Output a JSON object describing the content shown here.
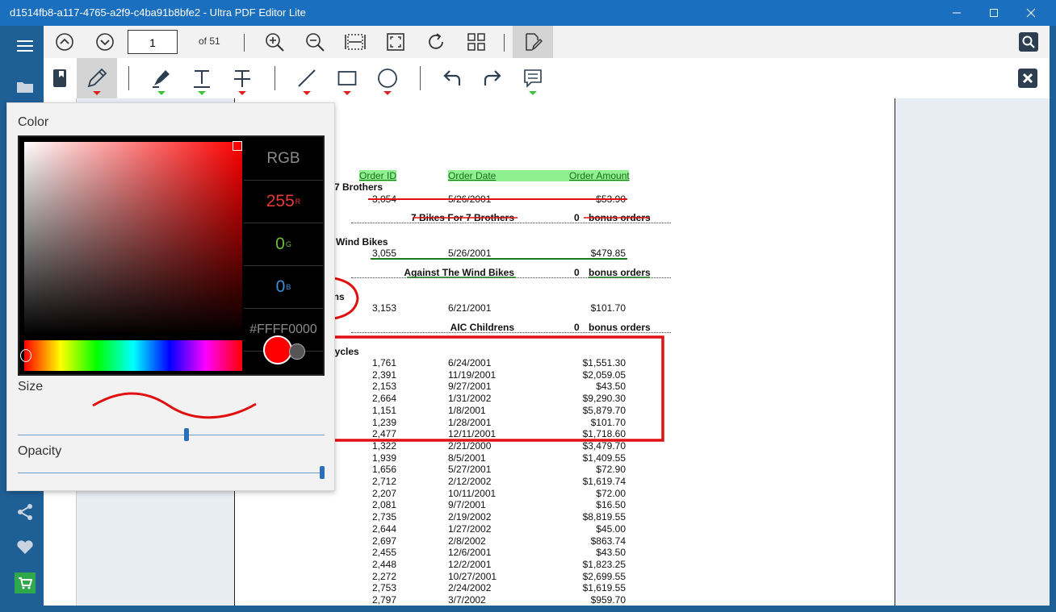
{
  "window": {
    "title": "d1514fb8-a117-4765-a2f9-c4ba91b8bfe2 - Ultra PDF Editor Lite"
  },
  "nav": {
    "current_page": "1",
    "page_count_label": "of 51"
  },
  "document": {
    "headers": [
      "Order ID",
      "Order Date",
      "Order Amount"
    ],
    "groups": [
      {
        "name": "r 7 Brothers",
        "rows": [
          [
            "3,054",
            "5/26/2001",
            "$53.90"
          ]
        ],
        "summary_name": "7 Bikes For 7 Brothers",
        "summary_count": "0",
        "summary_label": "bonus orders"
      },
      {
        "name": "e Wind Bikes",
        "rows": [
          [
            "3,055",
            "5/26/2001",
            "$479.85"
          ]
        ],
        "summary_name": "Against The Wind Bikes",
        "summary_count": "0",
        "summary_label": "bonus orders"
      },
      {
        "name": "ens",
        "rows": [
          [
            "3,153",
            "6/21/2001",
            "$101.70"
          ]
        ],
        "summary_name": "AIC Childrens",
        "summary_count": "0",
        "summary_label": "bonus orders"
      }
    ],
    "cycles_group_label": "Cycles",
    "cycles_rows": [
      [
        "1,761",
        "6/24/2001",
        "$1,551.30"
      ],
      [
        "2,391",
        "11/19/2001",
        "$2,059.05"
      ],
      [
        "2,153",
        "9/27/2001",
        "$43.50"
      ],
      [
        "2,664",
        "1/31/2002",
        "$9,290.30"
      ],
      [
        "1,151",
        "1/8/2001",
        "$5,879.70"
      ],
      [
        "1,239",
        "1/28/2001",
        "$101.70"
      ],
      [
        "2,477",
        "12/11/2001",
        "$1,718.60"
      ],
      [
        "1,322",
        "2/21/2000",
        "$3,479.70"
      ],
      [
        "1,939",
        "8/5/2001",
        "$1,409.55"
      ],
      [
        "1,656",
        "5/27/2001",
        "$72.90"
      ],
      [
        "2,712",
        "2/12/2002",
        "$1,619.74"
      ],
      [
        "2,207",
        "10/11/2001",
        "$72.00"
      ],
      [
        "2,081",
        "9/7/2001",
        "$16.50"
      ],
      [
        "2,735",
        "2/19/2002",
        "$8,819.55"
      ],
      [
        "2,644",
        "1/27/2002",
        "$45.00"
      ],
      [
        "2,697",
        "2/8/2002",
        "$863.74"
      ],
      [
        "2,455",
        "12/6/2001",
        "$43.50"
      ],
      [
        "2,448",
        "12/2/2001",
        "$1,823.25"
      ],
      [
        "2,272",
        "10/27/2001",
        "$2,699.55"
      ],
      [
        "2,753",
        "2/24/2002",
        "$1,619.55"
      ],
      [
        "2,797",
        "3/7/2002",
        "$959.70"
      ]
    ]
  },
  "color_popup": {
    "color_label": "Color",
    "mode_label": "RGB",
    "r_value": "255",
    "r_label": "R",
    "g_value": "0",
    "g_label": "G",
    "b_value": "0",
    "b_label": "B",
    "hex_value": "#FFFF0000",
    "size_label": "Size",
    "opacity_label": "Opacity",
    "size_level": 0.55,
    "opacity_level": 1.0,
    "selected_color": "#ff0000"
  },
  "icons": {
    "nav": [
      "menu-icon",
      "folder-icon",
      "share-icon",
      "heart-icon",
      "cart-icon"
    ],
    "toolbar1": [
      "page-up-icon",
      "page-down-icon",
      "zoom-in-icon",
      "zoom-out-icon",
      "fit-width-icon",
      "fit-page-icon",
      "rotate-icon",
      "grid-view-icon",
      "edit-mode-icon",
      "search-icon"
    ],
    "toolbar2": [
      "bookmark-icon",
      "pen-icon",
      "highlighter-icon",
      "text-icon",
      "strikethrough-icon",
      "line-icon",
      "rectangle-icon",
      "ellipse-icon",
      "undo-icon",
      "redo-icon",
      "comment-icon",
      "close-icon"
    ]
  },
  "colors": {
    "accent": "#1b6fbf",
    "annotation_red": "#e01010",
    "header_highlight": "#8ef08e"
  }
}
